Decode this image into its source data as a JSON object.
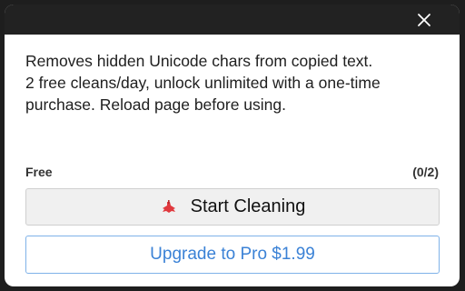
{
  "window": {
    "close_icon": "close-icon"
  },
  "description": {
    "line1": "Removes hidden Unicode chars from copied text.",
    "line2": "2 free cleans/day, unlock unlimited with a one-time purchase. Reload page before using."
  },
  "usage": {
    "plan_label": "Free",
    "count_label": "(0/2)"
  },
  "actions": {
    "start_label": "Start Cleaning",
    "start_icon": "broom-icon",
    "upgrade_label": "Upgrade to Pro $1.99"
  },
  "colors": {
    "titlebar": "#222222",
    "accent": "#3b82d6",
    "icon_red": "#e0393e"
  }
}
